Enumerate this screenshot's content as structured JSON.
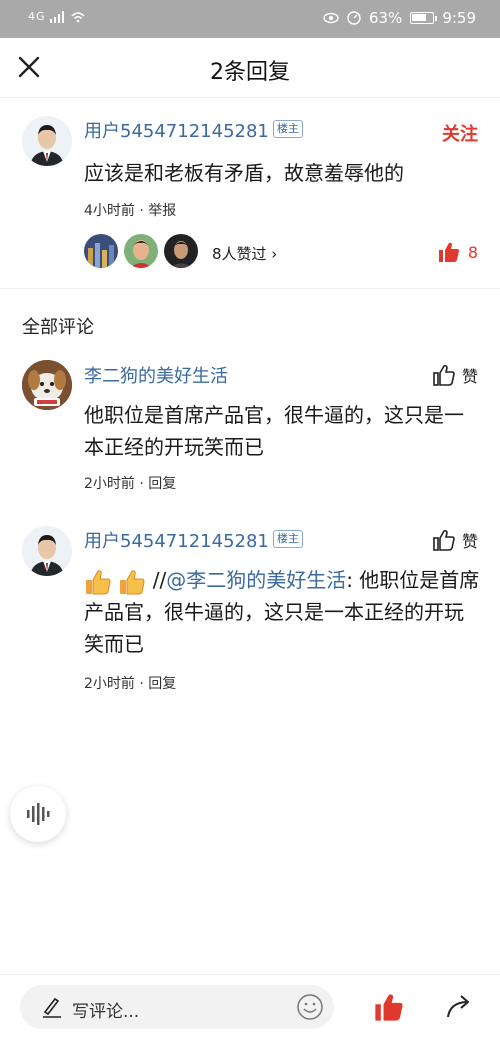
{
  "status_bar": {
    "network": "4G",
    "battery": "63%",
    "time": "9:59"
  },
  "header": {
    "title": "2条回复"
  },
  "original_comment": {
    "username": "用户5454712145281",
    "badge": "楼主",
    "follow_label": "关注",
    "text": "应该是和老板有矛盾，故意羞辱他的",
    "meta": "4小时前 · 举报",
    "likers_text": "8人赞过 ›",
    "like_count": "8"
  },
  "section": {
    "title": "全部评论"
  },
  "replies": [
    {
      "username": "李二狗的美好生活",
      "like_label": "赞",
      "text": "他职位是首席产品官，很牛逼的，这只是一本正经的开玩笑而已",
      "meta": "2小时前 · 回复"
    },
    {
      "username": "用户5454712145281",
      "badge": "楼主",
      "like_label": "赞",
      "prefix": "//",
      "mention": "@李二狗的美好生活",
      "text": ": 他职位是首席产品官，很牛逼的，这只是一本正经的开玩笑而已",
      "meta": "2小时前 · 回复"
    }
  ],
  "bottom_bar": {
    "placeholder": "写评论..."
  },
  "colors": {
    "accent_red": "#e03a2f",
    "link_blue": "#3a6aa0",
    "status_bar_bg": "#a9a9a9"
  }
}
